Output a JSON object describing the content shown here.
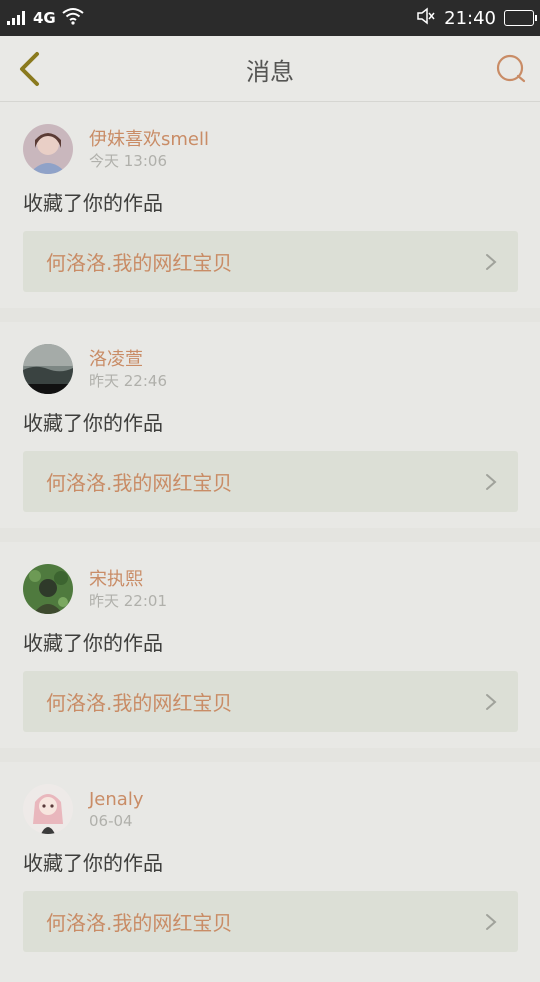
{
  "status_bar": {
    "network": "4G",
    "time": "21:40",
    "icons": [
      "signal-icon",
      "wifi-icon",
      "mute-icon",
      "battery-icon"
    ]
  },
  "nav": {
    "title": "消息",
    "back_icon": "chevron-left-icon",
    "search_icon": "search-icon"
  },
  "colors": {
    "accent": "#c98c66",
    "back_arrow": "#8a7a1e",
    "background": "#e4e4e0",
    "card": "#e8e8e5",
    "link_box": "#dcdfd6"
  },
  "messages": [
    {
      "user": "伊妹喜欢smell",
      "time": "今天 13:06",
      "action": "收藏了你的作品",
      "work": "何洛洛.我的网红宝贝",
      "avatar": "avatar-girl-photo"
    },
    {
      "user": "洛凌萱",
      "time": "昨天 22:46",
      "action": "收藏了你的作品",
      "work": "何洛洛.我的网红宝贝",
      "avatar": "avatar-landscape-photo"
    },
    {
      "user": "宋执熙",
      "time": "昨天 22:01",
      "action": "收藏了你的作品",
      "work": "何洛洛.我的网红宝贝",
      "avatar": "avatar-green-photo"
    },
    {
      "user": "Jenaly",
      "time": "06-04",
      "action": "收藏了你的作品",
      "work": "何洛洛.我的网红宝贝",
      "avatar": "avatar-anime-girl"
    }
  ]
}
